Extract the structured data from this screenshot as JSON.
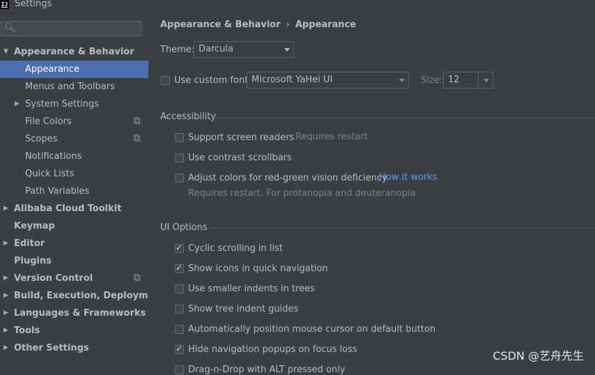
{
  "window": {
    "title": "Settings",
    "app_icon": "IJ"
  },
  "search": {
    "placeholder": ""
  },
  "sidebar": {
    "items": [
      {
        "label": "Appearance & Behavior"
      },
      {
        "label": "Appearance"
      },
      {
        "label": "Menus and Toolbars"
      },
      {
        "label": "System Settings"
      },
      {
        "label": "File Colors"
      },
      {
        "label": "Scopes"
      },
      {
        "label": "Notifications"
      },
      {
        "label": "Quick Lists"
      },
      {
        "label": "Path Variables"
      },
      {
        "label": "Alibaba Cloud Toolkit"
      },
      {
        "label": "Keymap"
      },
      {
        "label": "Editor"
      },
      {
        "label": "Plugins"
      },
      {
        "label": "Version Control"
      },
      {
        "label": "Build, Execution, Deployment"
      },
      {
        "label": "Languages & Frameworks"
      },
      {
        "label": "Tools"
      },
      {
        "label": "Other Settings"
      }
    ]
  },
  "breadcrumb": {
    "parent": "Appearance & Behavior",
    "separator": "›",
    "current": "Appearance"
  },
  "theme": {
    "label": "Theme:",
    "value": "Darcula"
  },
  "font": {
    "checkbox_label": "Use custom font:",
    "checked": false,
    "value": "Microsoft YaHei UI",
    "size_label": "Size:",
    "size_value": "12"
  },
  "accessibility": {
    "title": "Accessibility",
    "screen_readers": {
      "label": "Support screen readers",
      "hint": "Requires restart",
      "checked": false
    },
    "contrast_scrollbars": {
      "label": "Use contrast scrollbars",
      "checked": false
    },
    "color_deficiency": {
      "label": "Adjust colors for red-green vision deficiency",
      "link": "How it works",
      "hint": "Requires restart. For protanopia and deuteranopia",
      "checked": false
    }
  },
  "ui_options": {
    "title": "UI Options",
    "items": [
      {
        "label": "Cyclic scrolling in list",
        "checked": true
      },
      {
        "label": "Show icons in quick navigation",
        "checked": true
      },
      {
        "label": "Use smaller indents in trees",
        "checked": false
      },
      {
        "label": "Show tree indent guides",
        "checked": false
      },
      {
        "label": "Automatically position mouse cursor on default button",
        "checked": false
      },
      {
        "label": "Hide navigation popups on focus loss",
        "checked": true
      },
      {
        "label": "Drag-n-Drop with ALT pressed only",
        "checked": false
      }
    ]
  },
  "watermark": "CSDN @艺舟先生",
  "colors": {
    "selection": "#4b6eaf",
    "link": "#589df6",
    "background": "#3c3f41"
  }
}
